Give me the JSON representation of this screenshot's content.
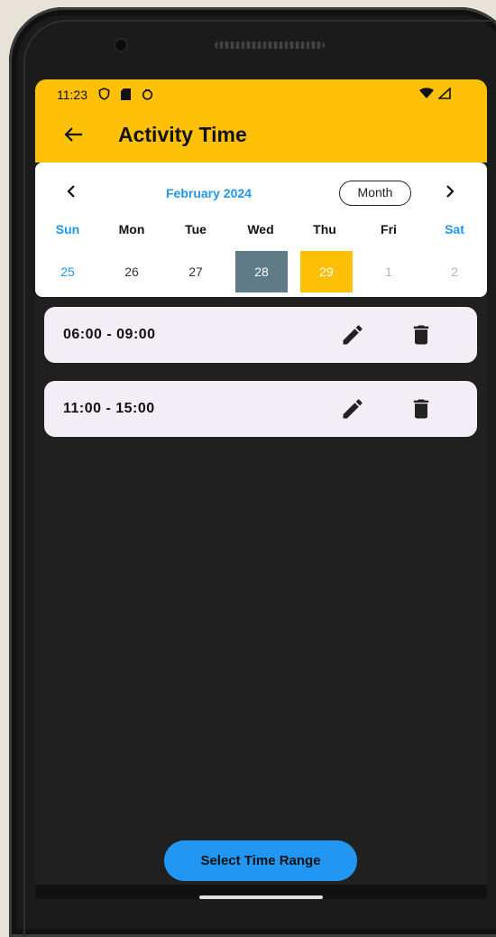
{
  "status_bar": {
    "time": "11:23",
    "icons": [
      "shield-icon",
      "sd-card-icon",
      "circle-icon"
    ],
    "right_icons": [
      "wifi-icon",
      "signal-icon"
    ]
  },
  "app_bar": {
    "title": "Activity Time",
    "back_icon": "arrow-left-icon",
    "color": "#ffc107"
  },
  "calendar": {
    "month_label": "February 2024",
    "view_toggle": "Month",
    "prev_icon": "chevron-left-icon",
    "next_icon": "chevron-right-icon",
    "weekdays": [
      "Sun",
      "Mon",
      "Tue",
      "Wed",
      "Thu",
      "Fri",
      "Sat"
    ],
    "dates": [
      "25",
      "26",
      "27",
      "28",
      "29",
      "1",
      "2"
    ],
    "selected_date": "28",
    "today_date": "29",
    "accent_color": "#2196f3",
    "selected_color": "#5f7b87"
  },
  "time_slots": [
    {
      "range": "06:00 - 09:00",
      "edit_icon": "pencil-icon",
      "delete_icon": "trash-icon"
    },
    {
      "range": "11:00 - 15:00",
      "edit_icon": "pencil-icon",
      "delete_icon": "trash-icon"
    }
  ],
  "footer": {
    "button_label": "Select Time Range"
  }
}
